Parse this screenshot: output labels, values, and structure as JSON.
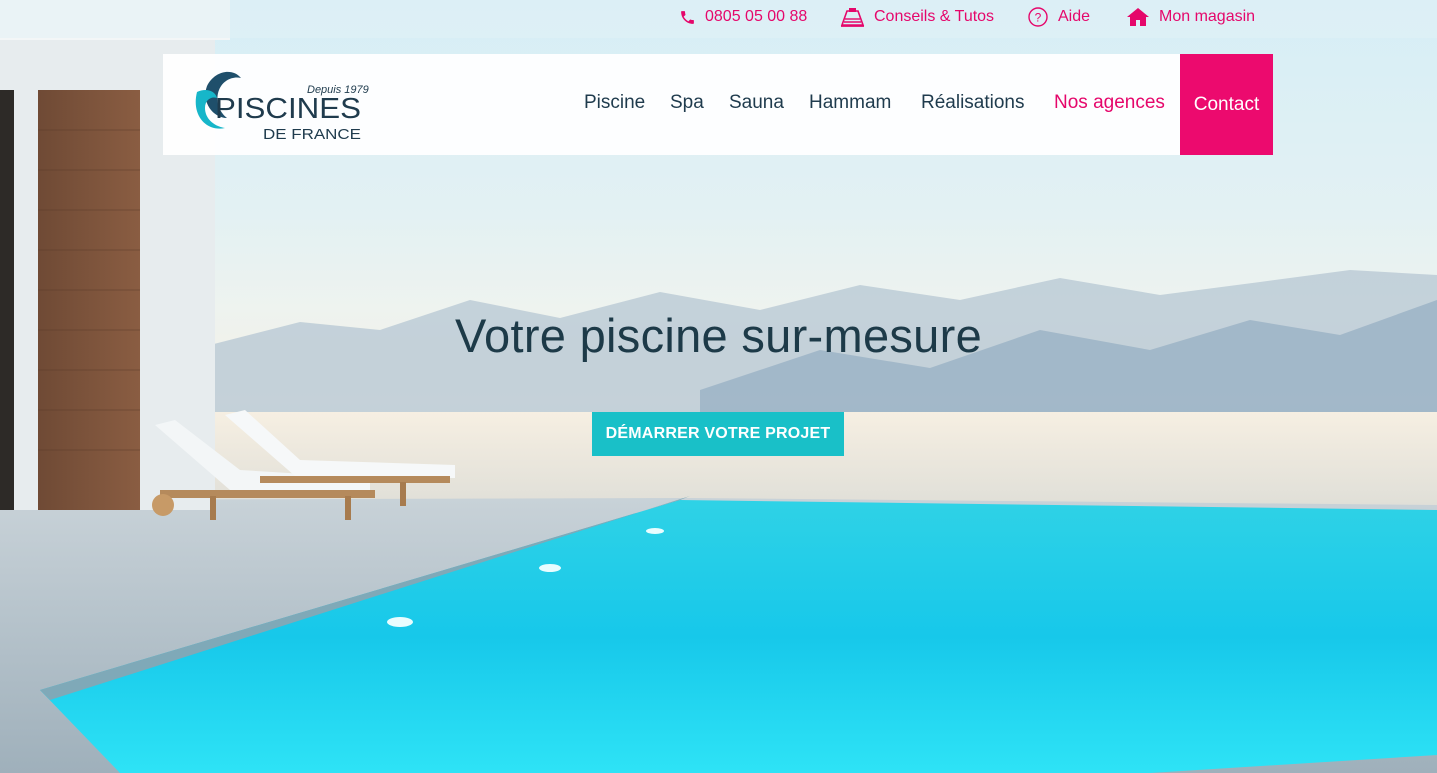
{
  "top_links": {
    "phone": "0805 05 00 88",
    "tips": "Conseils & Tutos",
    "help": "Aide",
    "store": "Mon magasin"
  },
  "logo": {
    "brand": "PISCINES",
    "sub": "DE FRANCE",
    "since": "Depuis 1979"
  },
  "nav": {
    "items": [
      "Piscine",
      "Spa",
      "Sauna",
      "Hammam",
      "Réalisations",
      "Nos agences"
    ],
    "contact": "Contact"
  },
  "hero": {
    "title": "Votre piscine sur-mesure",
    "cta": "DÉMARRER VOTRE PROJET"
  },
  "colors": {
    "accent": "#ec0a6e",
    "cta": "#19c0c8",
    "text_dark": "#1d3a48"
  },
  "icons": [
    "phone-icon",
    "book-icon",
    "help-icon",
    "home-icon"
  ]
}
